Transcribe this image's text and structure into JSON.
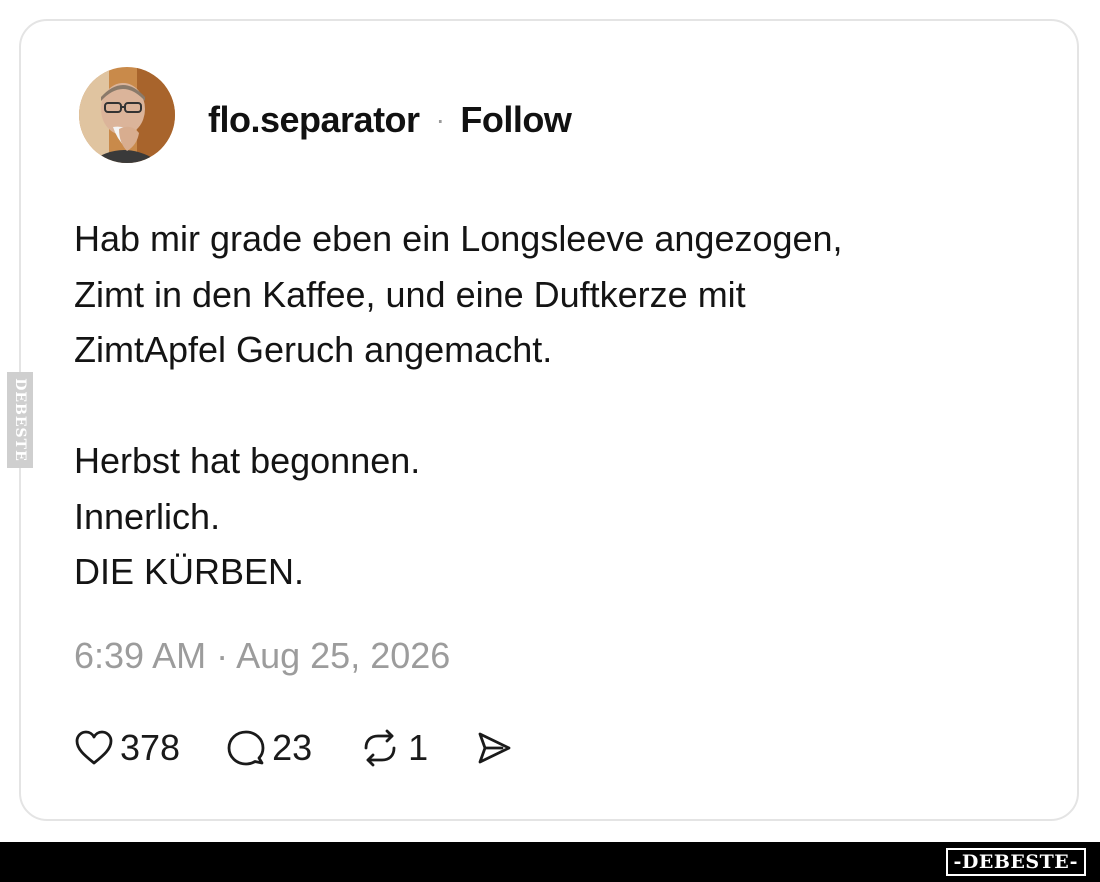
{
  "post": {
    "username": "flo.separator",
    "separator": "·",
    "follow_label": "Follow",
    "text": "Hab mir grade eben ein Longsleeve angezogen,\nZimt in den Kaffee, und eine Duftkerze mit\nZimtApfel Geruch angemacht.\n\nHerbst hat begonnen.\nInnerlich.\nDIE KÜRBEN.",
    "timestamp": "6:39 AM · Aug 25, 2026",
    "actions": {
      "like_count": "378",
      "reply_count": "23",
      "repost_count": "1"
    }
  },
  "icons": {
    "like": "heart-icon",
    "reply": "comment-bubble-icon",
    "repost": "repost-arrows-icon",
    "share": "send-icon"
  },
  "watermark": {
    "side_text": "DEBESTE",
    "footer_text": "-DEBESTE-"
  },
  "colors": {
    "text": "#141414",
    "muted": "#9c9c9c",
    "card_border": "#e4e4e4",
    "footer_bg": "#000000"
  }
}
